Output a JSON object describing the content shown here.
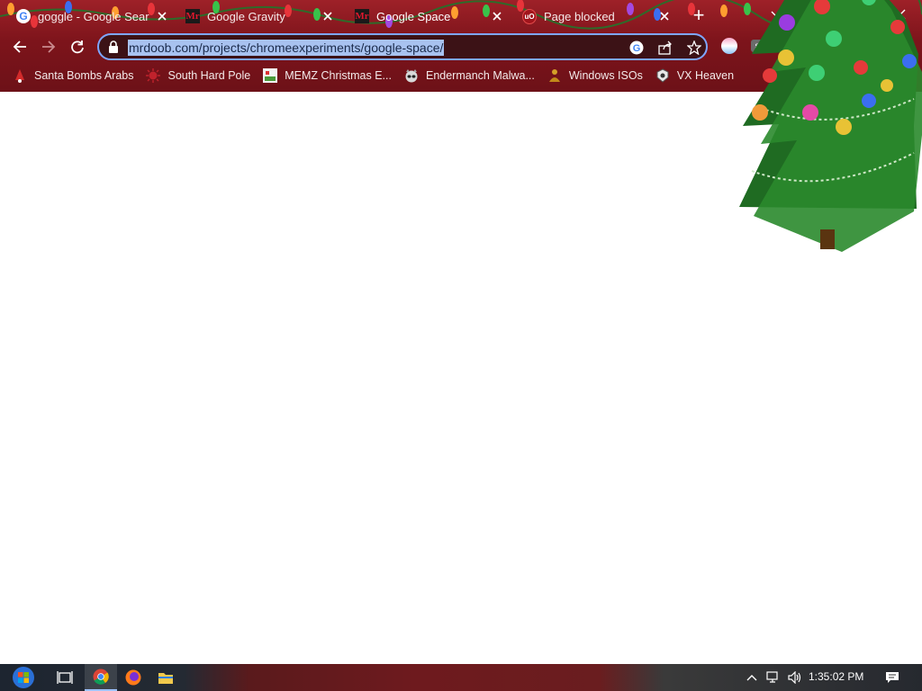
{
  "tabs": [
    {
      "title": "goggle - Google Search",
      "favicon": "google-icon",
      "active": false
    },
    {
      "title": "Google Gravity",
      "favicon": "mrdoob-icon",
      "active": false
    },
    {
      "title": "Google Space",
      "favicon": "mrdoob-icon",
      "active": true
    },
    {
      "title": "Page blocked",
      "favicon": "ublock-icon",
      "active": false
    }
  ],
  "omnibox": {
    "url": "mrdoob.com/projects/chromeexperiments/google-space/"
  },
  "bookmarks": [
    {
      "label": "Santa Bombs Arabs",
      "icon": "santa-icon"
    },
    {
      "label": "South Hard Pole",
      "icon": "virus-icon"
    },
    {
      "label": "MEMZ Christmas E...",
      "icon": "memz-icon"
    },
    {
      "label": "Endermanch Malwa...",
      "icon": "raccoon-icon"
    },
    {
      "label": "Windows ISOs",
      "icon": "buddha-icon"
    },
    {
      "label": "VX Heaven",
      "icon": "vx-icon"
    }
  ],
  "taskbar": {
    "clock": "1:35:02 PM"
  },
  "colors": {
    "frame": "#7d141b",
    "omnibox_border": "#7ea6ff",
    "selection": "#a8c2f0"
  }
}
